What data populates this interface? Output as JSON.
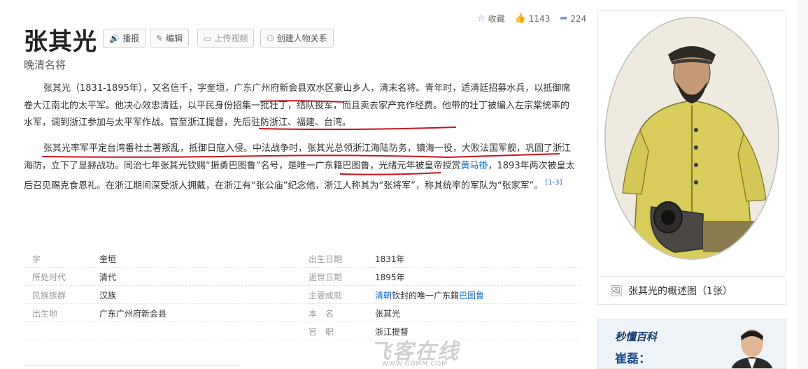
{
  "title": "张其光",
  "subtitle": "晚清名将",
  "buttons": {
    "broadcast": "播报",
    "edit": "编辑",
    "upload_video": "上传视频",
    "create_relation": "创建人物关系"
  },
  "stats": {
    "favorite": "收藏",
    "likes": "1143",
    "shares": "224"
  },
  "paragraph1": {
    "text": "张其光（1831-1895年），又名信千，字奎垣，广东广州府新会县双水区豪山乡人，清末名将。青年时，适清廷招募水兵，以抵御席卷大江南北的太平军。他决心效忠清廷，以平民身份招集一批壮丁，结队投军，而且卖去家产充作经费。他带的壮丁被编入左宗棠统率的水军，调到浙江参加与太平军作战。官至浙江提督，先后驻防浙江、福建、台湾。"
  },
  "paragraph2": {
    "text_before_link1": "张其光率军平定台湾番社土著叛乱，抵御日寇入侵。中法战争时，张其光总领浙江海陆防务，镇海一役，大败法国军舰，巩固了浙江海防，立下了显赫战功。同治七年张其光钦赐“振勇巴图鲁”名号，是唯一广东籍巴图鲁，光绪元年被皇帝授赏",
    "link1": "黄马褂",
    "text_after_link1": "，1893年两次被皇太后召见赐克食恩礼。在浙江期间深受浙人拥戴，在浙江有“张公庙”纪念他，浙江人称其为“张将军”，称其统率的军队为“张家军”。",
    "ref": "[1-3]"
  },
  "info": [
    {
      "k1": "字",
      "v1": "奎垣",
      "k2": "出生日期",
      "v2": "1831年"
    },
    {
      "k1": "所处时代",
      "v1": "清代",
      "k2": "逝世日期",
      "v2": "1895年"
    },
    {
      "k1": "民族族群",
      "v1": "汉族",
      "k2": "主要成就",
      "v2_link1": "清朝",
      "v2_mid": "钦封的唯一广东籍",
      "v2_link2": "巴图鲁"
    },
    {
      "k1": "出生地",
      "v1": "广东广州府新会县",
      "k2": "本　名",
      "v2": "张其光"
    },
    {
      "k1": "",
      "v1": "",
      "k2": "官　职",
      "v2": "浙江提督"
    }
  ],
  "side": {
    "caption": "张其光的概述图（1张）"
  },
  "ad": {
    "logo": "秒懂百科",
    "name": "崔磊："
  },
  "watermark": {
    "big": "飞客在线",
    "small": "WWW.GDMM.COM"
  },
  "colors": {
    "link": "#136ec2",
    "underline": "#c8141e"
  }
}
